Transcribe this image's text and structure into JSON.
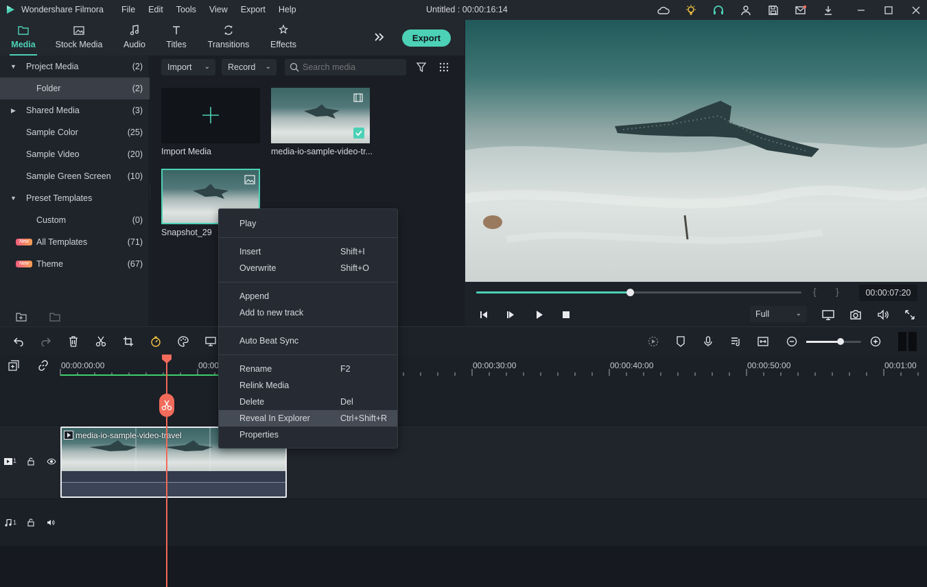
{
  "app": {
    "name": "Wondershare Filmora",
    "menu": [
      "File",
      "Edit",
      "Tools",
      "View",
      "Export",
      "Help"
    ],
    "project_title": "Untitled : 00:00:16:14"
  },
  "tabs": [
    {
      "label": "Media",
      "icon": "folder-icon",
      "active": true
    },
    {
      "label": "Stock Media",
      "icon": "stock-media-icon"
    },
    {
      "label": "Audio",
      "icon": "music-note-icon"
    },
    {
      "label": "Titles",
      "icon": "text-icon"
    },
    {
      "label": "Transitions",
      "icon": "transitions-icon"
    },
    {
      "label": "Effects",
      "icon": "effects-icon"
    }
  ],
  "export_label": "Export",
  "library": [
    {
      "label": "Project Media",
      "count": "(2)",
      "caret": "down"
    },
    {
      "label": "Folder",
      "count": "(2)",
      "selected": true
    },
    {
      "label": "Shared Media",
      "count": "(3)",
      "caret": "right"
    },
    {
      "label": "Sample Color",
      "count": "(25)"
    },
    {
      "label": "Sample Video",
      "count": "(20)"
    },
    {
      "label": "Sample Green Screen",
      "count": "(10)"
    },
    {
      "label": "Preset Templates",
      "count": "",
      "caret": "down"
    },
    {
      "label": "Custom",
      "count": "(0)"
    },
    {
      "label": "All Templates",
      "count": "(71)",
      "badge": "New"
    },
    {
      "label": "Theme",
      "count": "(67)",
      "badge": "New"
    }
  ],
  "media_toolbar": {
    "import_label": "Import",
    "record_label": "Record",
    "search_placeholder": "Search media"
  },
  "media_items": [
    {
      "label": "Import Media"
    },
    {
      "label": "media-io-sample-video-tr..."
    },
    {
      "label": "Snapshot_29"
    }
  ],
  "preview": {
    "timecode": "00:00:07:20",
    "progress": 0.472,
    "quality": "Full",
    "mark_in": "{",
    "mark_out": "}"
  },
  "timeline": {
    "ruler": [
      "00:00:00:00",
      "00:00",
      "00:00:30:00",
      "00:00:40:00",
      "00:00:50:00",
      "00:01:00"
    ],
    "clip_title": "media-io-sample-video-travel",
    "zoom": 0.62,
    "video_track": "1",
    "audio_track": "1"
  },
  "context_menu": [
    {
      "label": "Play",
      "shortcut": ""
    },
    {
      "label": "Insert",
      "shortcut": "Shift+I"
    },
    {
      "label": "Overwrite",
      "shortcut": "Shift+O"
    },
    {
      "label": "Append",
      "shortcut": ""
    },
    {
      "label": "Add to new track",
      "shortcut": ""
    },
    {
      "label": "Auto Beat Sync",
      "shortcut": ""
    },
    {
      "label": "Rename",
      "shortcut": "F2"
    },
    {
      "label": "Relink Media",
      "shortcut": ""
    },
    {
      "label": "Delete",
      "shortcut": "Del"
    },
    {
      "label": "Reveal In Explorer",
      "shortcut": "Ctrl+Shift+R",
      "highlighted": true
    },
    {
      "label": "Properties",
      "shortcut": ""
    }
  ],
  "colors": {
    "accent": "#4cd1b6",
    "playhead": "#f26b5b"
  }
}
